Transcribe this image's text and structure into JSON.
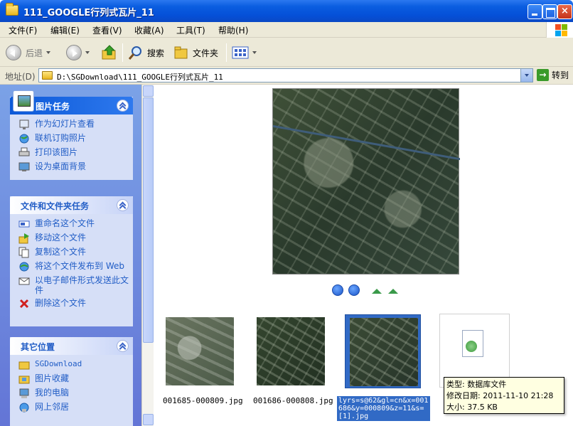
{
  "window": {
    "title": "111_GOOGLE行列式瓦片_11",
    "controls": {
      "minimize": "",
      "maximize": "",
      "close": "×"
    }
  },
  "menu": [
    "文件(F)",
    "编辑(E)",
    "查看(V)",
    "收藏(A)",
    "工具(T)",
    "帮助(H)"
  ],
  "toolbar": {
    "back_label": "后退",
    "search_label": "搜索",
    "folders_label": "文件夹"
  },
  "address": {
    "label": "地址(D)",
    "path": "D:\\SGDownload\\111_GOOGLE行列式瓦片_11",
    "go_label": "转到"
  },
  "left_pane": {
    "picture_tasks": {
      "title": "图片任务",
      "items": [
        "作为幻灯片查看",
        "联机订购照片",
        "打印该图片",
        "设为桌面背景"
      ]
    },
    "file_tasks": {
      "title": "文件和文件夹任务",
      "items": [
        "重命名这个文件",
        "移动这个文件",
        "复制这个文件",
        "将这个文件发布到 Web",
        "以电子邮件形式发送此文件",
        "删除这个文件"
      ]
    },
    "other_places": {
      "title": "其它位置",
      "items": [
        "SGDownload",
        "图片收藏",
        "我的电脑",
        "网上邻居"
      ]
    }
  },
  "thumbnails": [
    {
      "label": "001685-000809.jpg"
    },
    {
      "label": "001686-000808.jpg"
    },
    {
      "label": "lyrs=s@62&gl=cn&x=001686&y=000809&z=11&s=[1].jpg",
      "selected": true
    }
  ],
  "tooltip": {
    "type": "类型: 数据库文件",
    "modified": "修改日期: 2011-11-10 21:28",
    "size": "大小: 37.5 KB"
  },
  "colors": {
    "title_bar": "#0550d8",
    "task_pane": "#6f8ee0",
    "selection": "#316ac5",
    "link_text": "#215dc6"
  }
}
